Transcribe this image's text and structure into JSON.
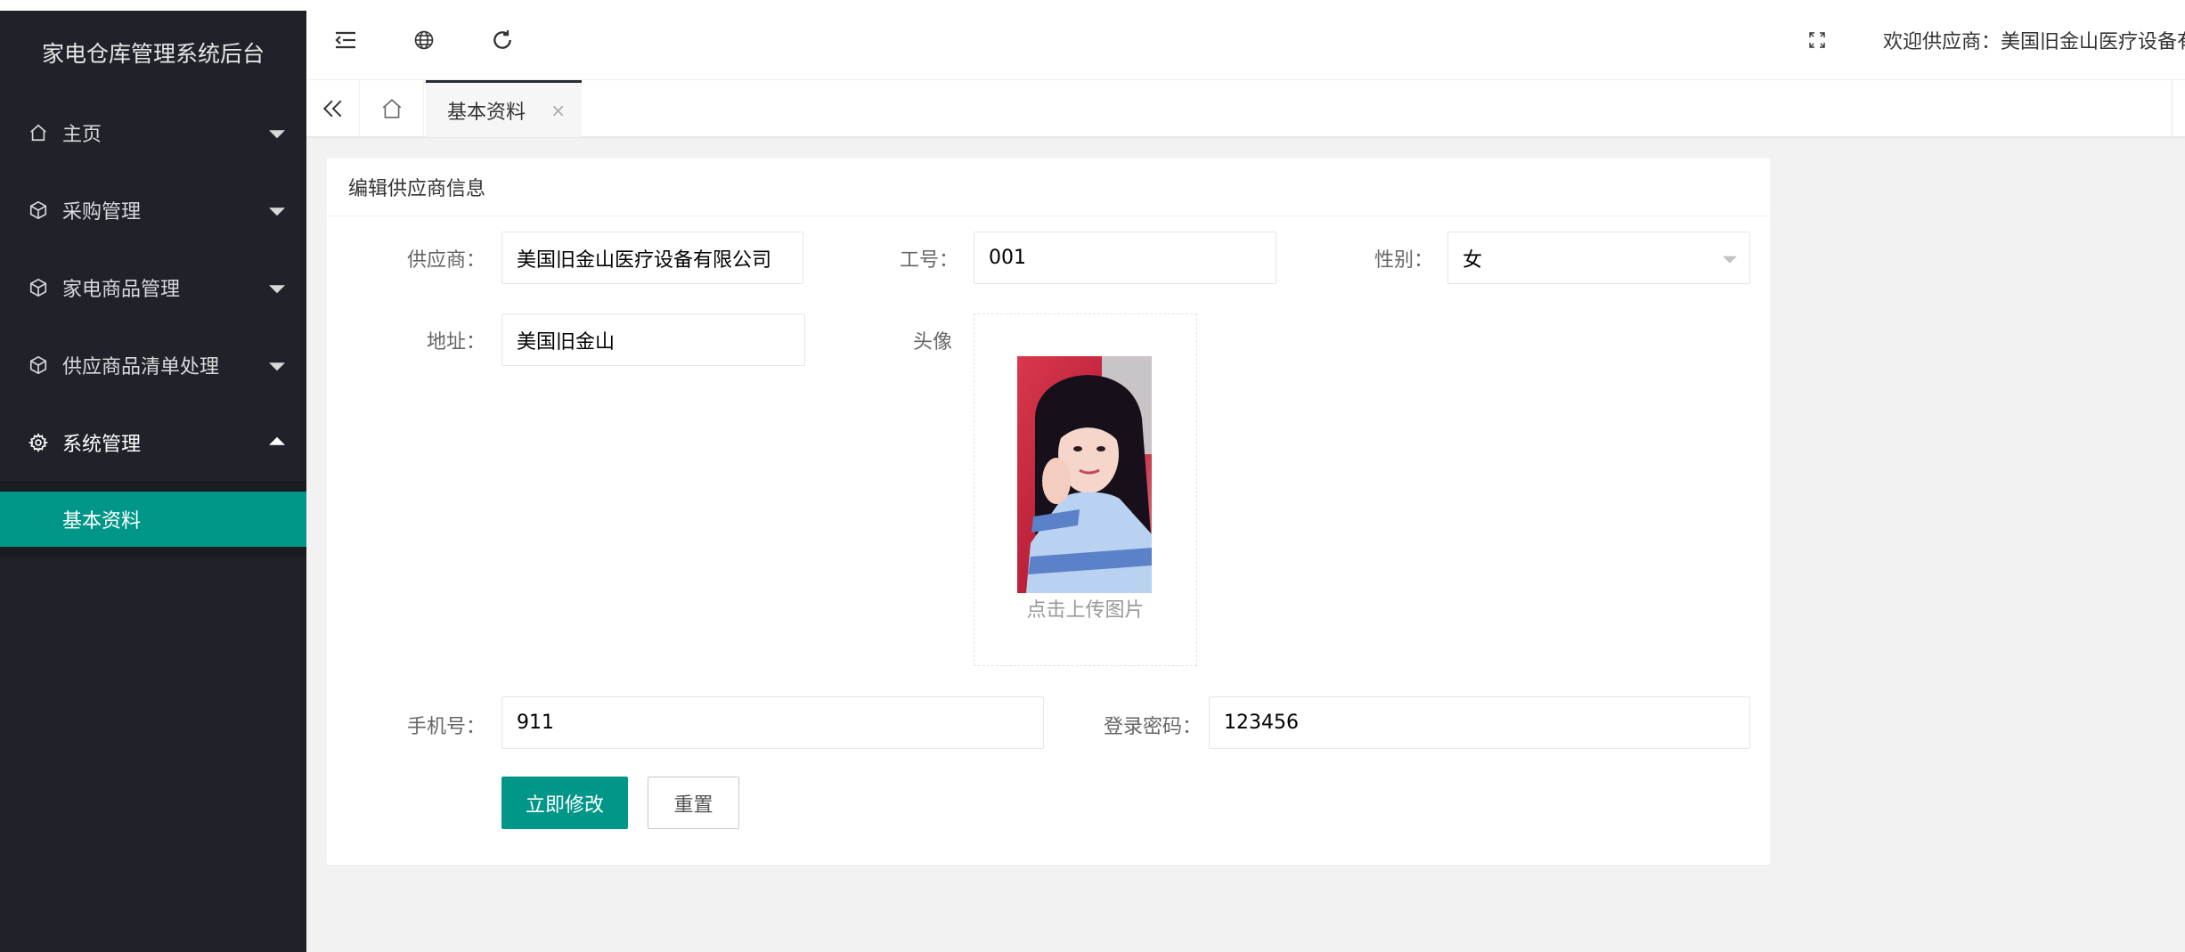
{
  "app": {
    "title": "家电仓库管理系统后台"
  },
  "sidebar": {
    "items": [
      {
        "label": "主页",
        "icon": "home-icon"
      },
      {
        "label": "采购管理",
        "icon": "cube-icon"
      },
      {
        "label": "家电商品管理",
        "icon": "cube-icon"
      },
      {
        "label": "供应商品清单处理",
        "icon": "cube-icon"
      },
      {
        "label": "系统管理",
        "icon": "gear-icon",
        "expanded": true
      }
    ],
    "submenu": [
      {
        "label": "基本资料",
        "active": true
      }
    ]
  },
  "header": {
    "welcome": "欢迎供应商：美国旧金山医疗设备有限公司"
  },
  "tabs": {
    "active_label": "基本资料",
    "close_glyph": "×"
  },
  "form": {
    "title": "编辑供应商信息",
    "supplier": {
      "label": "供应商：",
      "value": "美国旧金山医疗设备有限公司"
    },
    "job_no": {
      "label": "工号：",
      "value": "001"
    },
    "gender": {
      "label": "性别：",
      "value": "女"
    },
    "address": {
      "label": "地址：",
      "value": "美国旧金山"
    },
    "avatar": {
      "label": "头像",
      "upload_text": "点击上传图片"
    },
    "phone": {
      "label": "手机号：",
      "value": "911"
    },
    "password": {
      "label": "登录密码：",
      "value": "123456"
    },
    "submit_label": "立即修改",
    "reset_label": "重置"
  },
  "colors": {
    "sidebar_bg": "#20222a",
    "accent": "#009688",
    "page_bg": "#f2f2f2"
  }
}
